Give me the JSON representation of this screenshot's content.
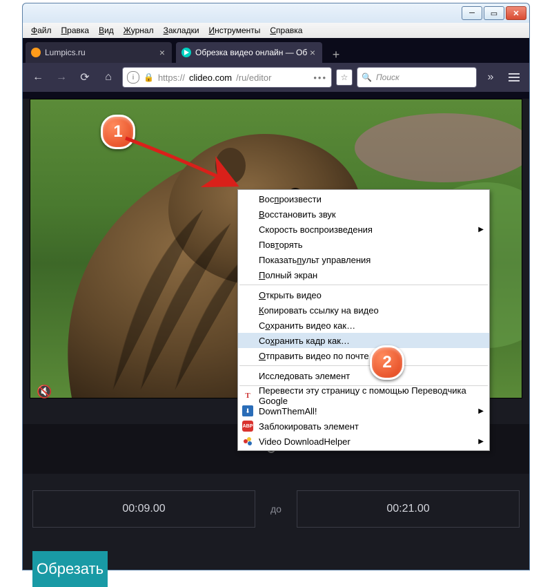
{
  "menubar": {
    "file": "Файл",
    "edit": "Правка",
    "view": "Вид",
    "history": "Журнал",
    "bookmarks": "Закладки",
    "tools": "Инструменты",
    "help": "Справка"
  },
  "tabs": [
    {
      "title": "Lumpics.ru",
      "icon": "lumpics"
    },
    {
      "title": "Обрезка видео онлайн — Об",
      "icon": "clideo"
    }
  ],
  "url": {
    "scheme": "https://",
    "host": "clideo.com",
    "path": "/ru/editor"
  },
  "search_placeholder": "Поиск",
  "mute_icon": "mute-icon",
  "trim": {
    "from": "00:09.00",
    "to_label": "до",
    "to": "00:21.00"
  },
  "cut_label": "Обрезать",
  "context_menu": {
    "items": [
      {
        "label": "Воспроизвести",
        "u": 3
      },
      {
        "label": "Восстановить звук",
        "u": 0
      },
      {
        "label": "Скорость воспроизведения",
        "sub": true
      },
      {
        "label": "Повторять",
        "u": 3
      },
      {
        "label": "Показать пульт управления",
        "u": 9
      },
      {
        "label": "Полный экран",
        "u": 0
      },
      "---",
      {
        "label": "Открыть видео",
        "u": 0
      },
      {
        "label": "Копировать ссылку на видео",
        "u": 0
      },
      {
        "label": "Сохранить видео как…",
        "u": 1
      },
      {
        "label": "Сохранить кадр как…",
        "u": 2,
        "hl": true
      },
      {
        "label": "Отправить видео по почте…",
        "u": 0
      },
      "---",
      {
        "label": "Исследовать элемент"
      },
      "---",
      {
        "label": "Перевести эту страницу с помощью Переводчика Google",
        "icon": "T-red"
      },
      {
        "label": "DownThemAll!",
        "icon": "dta",
        "sub": true
      },
      {
        "label": "Заблокировать элемент",
        "icon": "abp"
      },
      {
        "label": "Video DownloadHelper",
        "icon": "vdh",
        "sub": true
      }
    ]
  }
}
